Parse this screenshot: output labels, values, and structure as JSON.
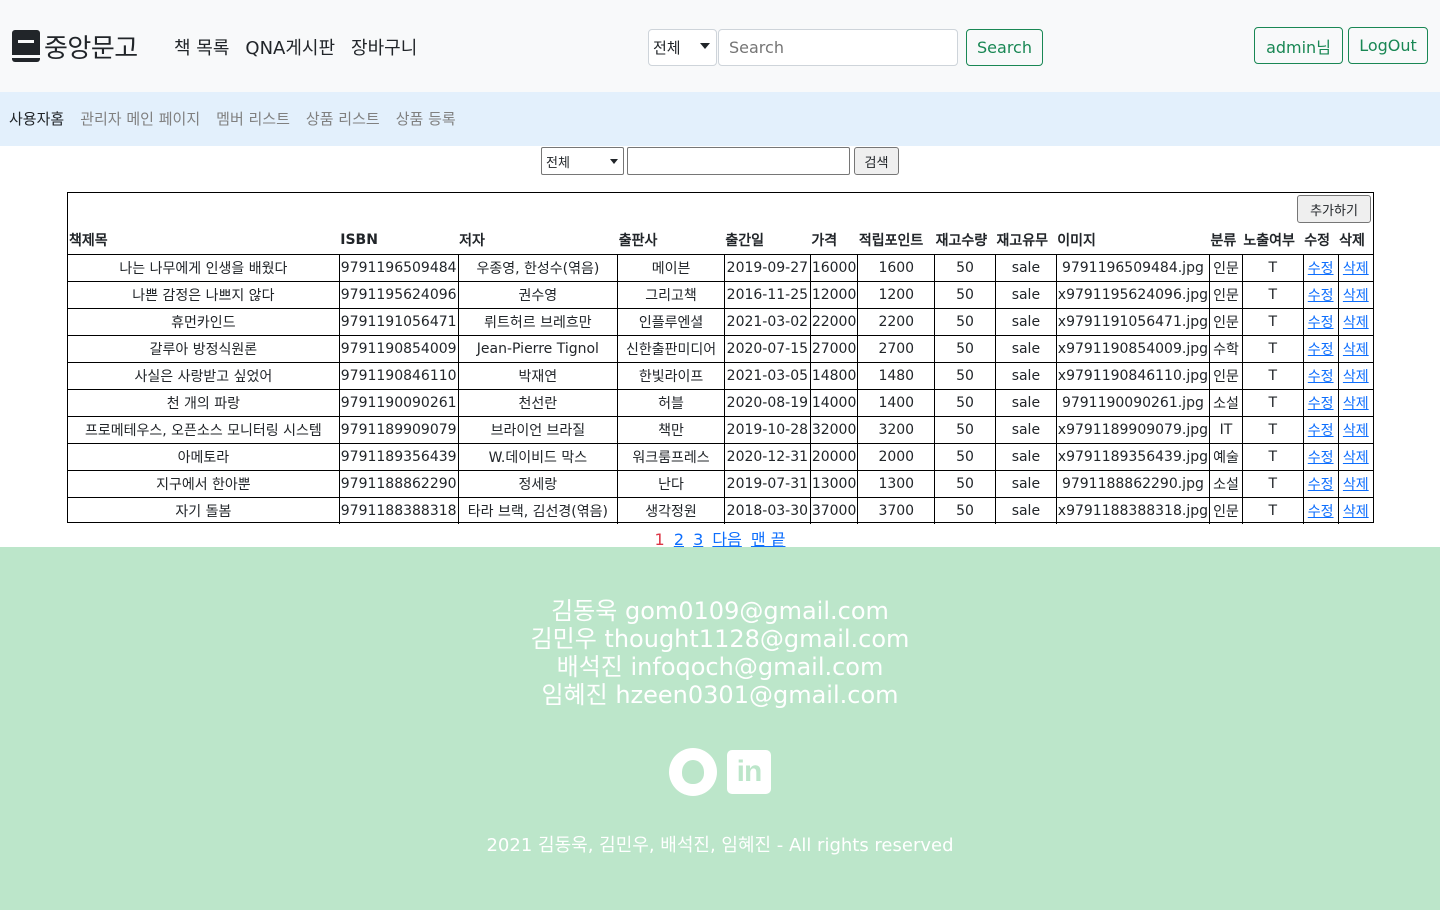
{
  "navbar": {
    "brand": "중앙문고",
    "links": [
      "책 목록",
      "QNA게시판",
      "장바구니"
    ],
    "search_select": "전체",
    "search_placeholder": "Search",
    "search_button": "Search",
    "user_button": "admin님",
    "logout_button": "LogOut"
  },
  "subnav": {
    "links": [
      "사용자홈",
      "관리자 메인 페이지",
      "멤버 리스트",
      "상품 리스트",
      "상품 등록"
    ]
  },
  "filter": {
    "select": "전체",
    "input_value": "",
    "button": "검색"
  },
  "table": {
    "add_button": "추가하기",
    "headers": [
      "책제목",
      "ISBN",
      "저자",
      "출판사",
      "출간일",
      "가격",
      "적립포인트",
      "재고수량",
      "재고유무",
      "이미지",
      "분류",
      "노출여부",
      "수정",
      "삭제"
    ],
    "edit_label": "수정",
    "delete_label": "삭제",
    "rows": [
      [
        "나는 나무에게 인생을 배웠다",
        "9791196509484",
        "우종영, 한성수(엮음)",
        "메이븐",
        "2019-09-27",
        "16000",
        "1600",
        "50",
        "sale",
        "9791196509484.jpg",
        "인문",
        "T"
      ],
      [
        "나쁜 감정은 나쁘지 않다",
        "9791195624096",
        "권수영",
        "그리고책",
        "2016-11-25",
        "12000",
        "1200",
        "50",
        "sale",
        "x9791195624096.jpg",
        "인문",
        "T"
      ],
      [
        "휴먼카인드",
        "9791191056471",
        "뤼트허르 브레흐만",
        "인플루엔셜",
        "2021-03-02",
        "22000",
        "2200",
        "50",
        "sale",
        "x9791191056471.jpg",
        "인문",
        "T"
      ],
      [
        "갈루아 방정식원론",
        "9791190854009",
        "Jean-Pierre Tignol",
        "신한출판미디어",
        "2020-07-15",
        "27000",
        "2700",
        "50",
        "sale",
        "x9791190854009.jpg",
        "수학",
        "T"
      ],
      [
        "사실은 사랑받고 싶었어",
        "9791190846110",
        "박재연",
        "한빛라이프",
        "2021-03-05",
        "14800",
        "1480",
        "50",
        "sale",
        "x9791190846110.jpg",
        "인문",
        "T"
      ],
      [
        "천 개의 파랑",
        "9791190090261",
        "천선란",
        "허블",
        "2020-08-19",
        "14000",
        "1400",
        "50",
        "sale",
        "9791190090261.jpg",
        "소설",
        "T"
      ],
      [
        "프로메테우스, 오픈소스 모니터링 시스템",
        "9791189909079",
        "브라이언 브라질",
        "책만",
        "2019-10-28",
        "32000",
        "3200",
        "50",
        "sale",
        "x9791189909079.jpg",
        "IT",
        "T"
      ],
      [
        "아메토라",
        "9791189356439",
        "W.데이비드 막스",
        "워크룸프레스",
        "2020-12-31",
        "20000",
        "2000",
        "50",
        "sale",
        "x9791189356439.jpg",
        "예술",
        "T"
      ],
      [
        "지구에서 한아뿐",
        "9791188862290",
        "정세랑",
        "난다",
        "2019-07-31",
        "13000",
        "1300",
        "50",
        "sale",
        "9791188862290.jpg",
        "소설",
        "T"
      ],
      [
        "자기 돌봄",
        "9791188388318",
        "타라 브랙, 김선경(엮음)",
        "생각정원",
        "2018-03-30",
        "37000",
        "3700",
        "50",
        "sale",
        "x9791188388318.jpg",
        "인문",
        "T"
      ]
    ]
  },
  "pagination": {
    "current": "1",
    "pages": [
      "2",
      "3"
    ],
    "next": "다음",
    "last": "맨 끝"
  },
  "footer": {
    "contacts": [
      "김동욱 gom0109@gmail.com",
      "김민우 thought1128@gmail.com",
      "배석진 infoqoch@gmail.com",
      "임혜진 hzeen0301@gmail.com"
    ],
    "copyright": "2021 김동욱, 김민우, 배석진, 임혜진 - All rights reserved",
    "linkedin_text": "in"
  },
  "colors": {
    "accent": "#198754",
    "subnav_bg": "#e3f0fc",
    "footer_bg": "#bce6ca",
    "link": "#0d6efd",
    "current_page": "#dc3545"
  }
}
